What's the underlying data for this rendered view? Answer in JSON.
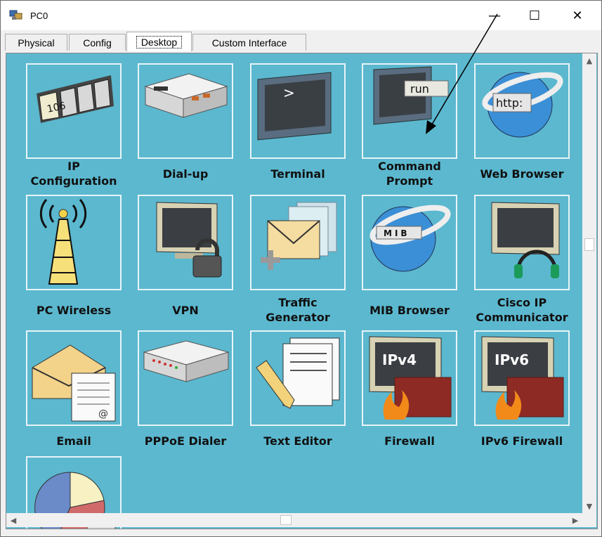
{
  "window": {
    "title": "PC0",
    "controls": {
      "minimize": "—",
      "maximize": "☐",
      "close": "✕"
    }
  },
  "tabs": [
    {
      "label": "Physical",
      "active": false
    },
    {
      "label": "Config",
      "active": false
    },
    {
      "label": "Desktop",
      "active": true
    },
    {
      "label": "Custom Interface",
      "active": false
    }
  ],
  "apps": [
    {
      "id": "ip-configuration",
      "label": "IP\nConfiguration",
      "icon": "ip-config-icon",
      "icon_text": "106"
    },
    {
      "id": "dial-up",
      "label": "Dial-up",
      "icon": "modem-icon"
    },
    {
      "id": "terminal",
      "label": "Terminal",
      "icon": "terminal-icon",
      "icon_text": ">"
    },
    {
      "id": "command-prompt",
      "label": "Command\nPrompt",
      "icon": "command-prompt-icon",
      "icon_text": "run"
    },
    {
      "id": "web-browser",
      "label": "Web Browser",
      "icon": "web-browser-icon",
      "icon_text": "http:"
    },
    {
      "id": "pc-wireless",
      "label": "PC Wireless",
      "icon": "wireless-tower-icon"
    },
    {
      "id": "vpn",
      "label": "VPN",
      "icon": "vpn-lock-icon"
    },
    {
      "id": "traffic-generator",
      "label": "Traffic\nGenerator",
      "icon": "traffic-generator-icon"
    },
    {
      "id": "mib-browser",
      "label": "MIB Browser",
      "icon": "mib-browser-icon",
      "icon_text": "MIB"
    },
    {
      "id": "cisco-ip-communicator",
      "label": "Cisco IP\nCommunicator",
      "icon": "headset-monitor-icon"
    },
    {
      "id": "email",
      "label": "Email",
      "icon": "email-icon"
    },
    {
      "id": "pppoe-dialer",
      "label": "PPPoE Dialer",
      "icon": "pppoe-device-icon"
    },
    {
      "id": "text-editor",
      "label": "Text Editor",
      "icon": "text-editor-icon"
    },
    {
      "id": "firewall",
      "label": "Firewall",
      "icon": "firewall-icon",
      "icon_text": "IPv4"
    },
    {
      "id": "ipv6-firewall",
      "label": "IPv6 Firewall",
      "icon": "ipv6-firewall-icon",
      "icon_text": "IPv6"
    },
    {
      "id": "pie-chart-app",
      "label": "",
      "icon": "pie-chart-icon"
    }
  ],
  "colors": {
    "desktop_bg": "#5bb8cf",
    "tile_border": "#e8f4f8",
    "annotation_arrow": "#000000"
  }
}
